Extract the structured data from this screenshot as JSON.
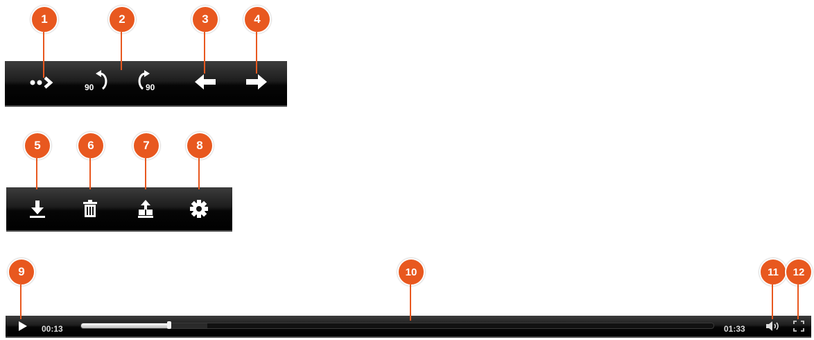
{
  "theme": {
    "accent": "#e8581f",
    "toolbar_bg": "#111111",
    "icon_color": "#ffffff"
  },
  "toolbar_top": {
    "items": [
      {
        "callout": "1",
        "icon": "more-arrow-icon"
      },
      {
        "callout": "2",
        "icon": "rotate-left-90-icon",
        "text": "90"
      },
      {
        "callout": "3",
        "icon": "rotate-right-90-icon",
        "text": "90"
      },
      {
        "callout": "4",
        "icon": "arrow-left-icon"
      },
      {
        "callout": "5",
        "icon": "arrow-right-icon"
      }
    ]
  },
  "toolbar_mid": {
    "items": [
      {
        "callout": "5",
        "icon": "download-icon"
      },
      {
        "callout": "6",
        "icon": "trash-icon"
      },
      {
        "callout": "7",
        "icon": "upload-icon"
      },
      {
        "callout": "8",
        "icon": "gear-icon"
      }
    ]
  },
  "player": {
    "current_time": "00:13",
    "total_time": "01:33",
    "progress": 0.14,
    "buffered": 0.2,
    "callouts": {
      "play": "9",
      "seek": "10",
      "volume": "11",
      "fullscreen": "12"
    },
    "icons": {
      "play": "play-icon",
      "volume": "volume-icon",
      "fullscreen": "fullscreen-icon"
    }
  }
}
